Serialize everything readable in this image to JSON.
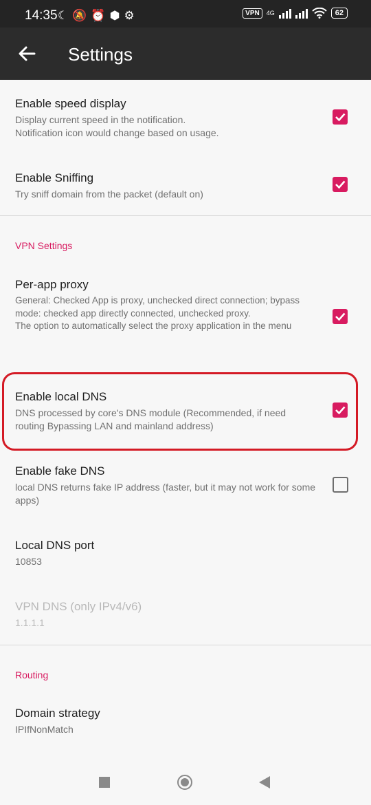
{
  "status_bar": {
    "time": "14:35",
    "vpn": "VPN",
    "network": "4G",
    "battery": "62"
  },
  "app_bar": {
    "title": "Settings"
  },
  "prefs": {
    "speed": {
      "title": "Enable speed display",
      "summary": "Display current speed in the notification.\nNotification icon would change based on usage.",
      "checked": true
    },
    "sniffing": {
      "title": "Enable Sniffing",
      "summary": "Try sniff domain from the packet (default on)",
      "checked": true
    },
    "vpn_category": "VPN Settings",
    "per_app": {
      "title": "Per-app proxy",
      "summary": "General: Checked App is proxy, unchecked direct connection; bypass mode: checked app directly connected, unchecked proxy.\nThe option to automatically select the proxy application in the menu",
      "checked": true
    },
    "local_dns": {
      "title": "Enable local DNS",
      "summary": "DNS processed by core's DNS module (Recommended, if need routing Bypassing LAN and mainland address)",
      "checked": true
    },
    "fake_dns": {
      "title": "Enable fake DNS",
      "summary": "local DNS returns fake IP address (faster, but it may not work for some apps)",
      "checked": false
    },
    "dns_port": {
      "title": "Local DNS port",
      "summary": "10853"
    },
    "vpn_dns": {
      "title": "VPN DNS (only IPv4/v6)",
      "summary": "1.1.1.1"
    },
    "routing_category": "Routing",
    "domain_strategy": {
      "title": "Domain strategy",
      "summary": "IPIfNonMatch"
    }
  },
  "colors": {
    "accent": "#d81b60",
    "highlight": "#d41a25",
    "appbar": "#2c2c2c"
  }
}
